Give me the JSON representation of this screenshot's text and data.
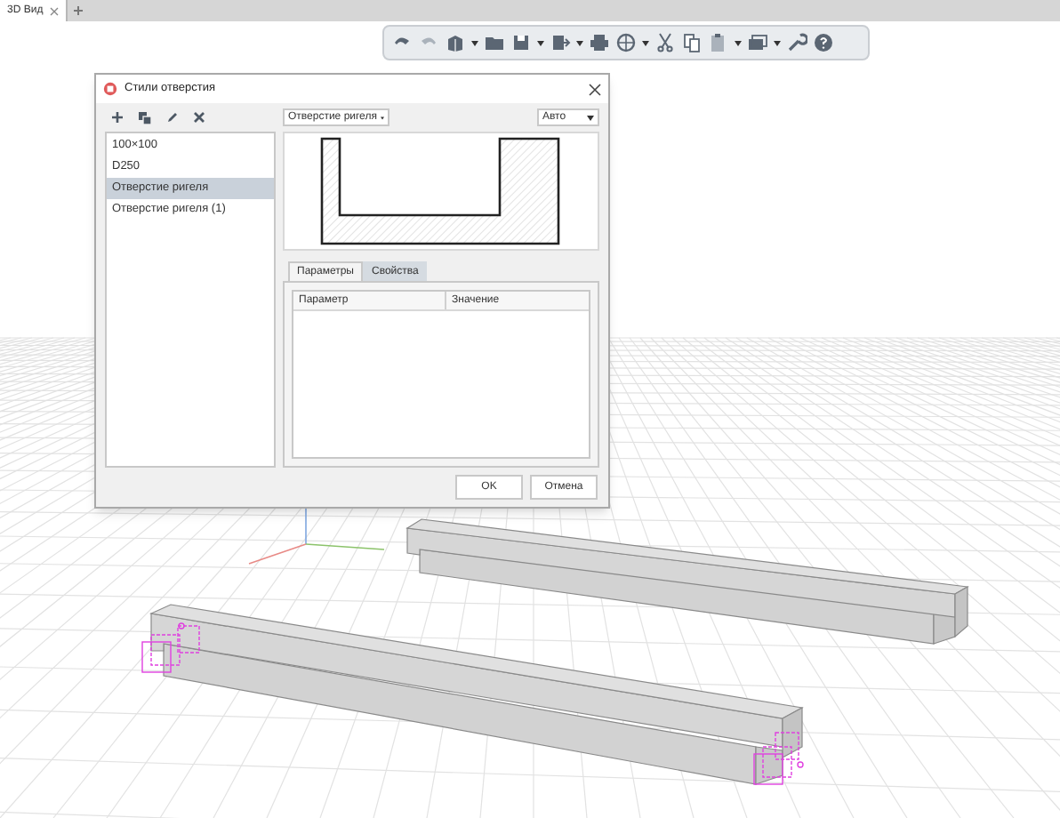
{
  "tabs": [
    {
      "label": "3D Вид",
      "selected": true
    }
  ],
  "dialog": {
    "title": "Стили отверстия",
    "styles": [
      {
        "label": "100×100",
        "selected": false
      },
      {
        "label": "D250",
        "selected": false
      },
      {
        "label": "Отверстие ригеля",
        "selected": true
      },
      {
        "label": "Отверстие ригеля (1)",
        "selected": false
      }
    ],
    "style_dropdown": "Отверстие ригеля",
    "scale_dropdown": "Авто",
    "tabs": [
      {
        "label": "Параметры",
        "selected": true
      },
      {
        "label": "Свойства",
        "selected": false
      }
    ],
    "table": {
      "columns": [
        "Параметр",
        "Значение"
      ]
    },
    "buttons": [
      "OK",
      "Отмена"
    ]
  }
}
